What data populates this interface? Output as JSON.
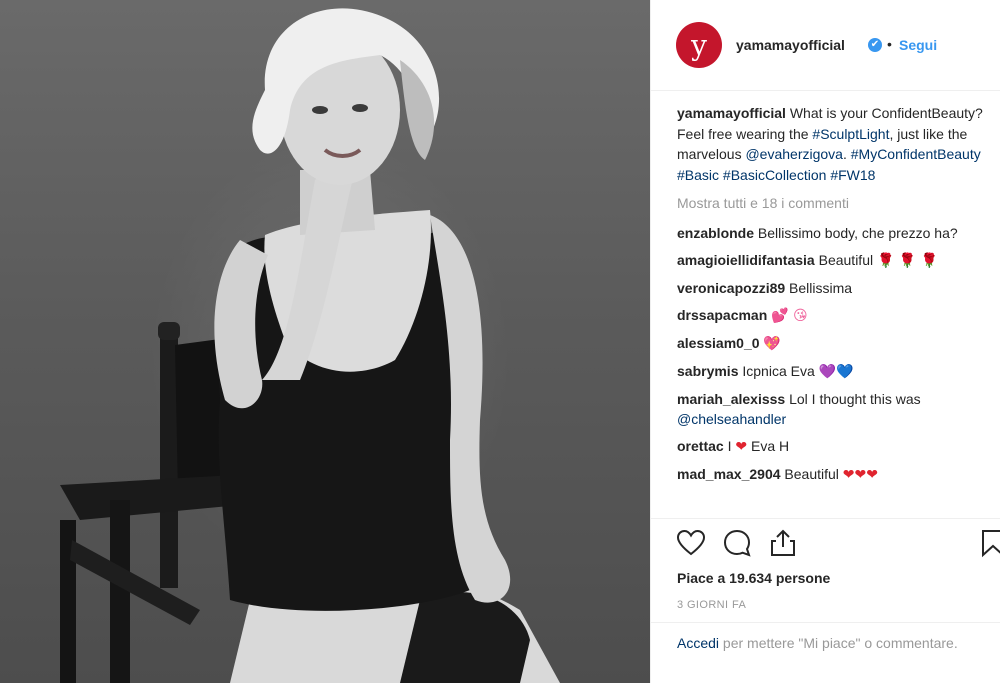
{
  "post": {
    "account": {
      "username": "yamamayofficial",
      "avatar_letter": "y",
      "avatar_color": "#c4162c",
      "verified_glyph": "✔",
      "separator": "•",
      "follow_label": "Segui",
      "follow_color": "#3897f0"
    },
    "caption": {
      "username": "yamamayofficial",
      "text_1": " What is your ConfidentBeauty? Feel free wearing the ",
      "tag_1": "#SculptLight",
      "text_2": ", just like the marvelous ",
      "tag_2": "@evaherzigova",
      "text_3": ". ",
      "tag_3": "#MyConfidentBeauty",
      "tag_4": "#Basic",
      "tag_5": "#BasicCollection",
      "tag_6": "#FW18"
    },
    "show_all_comments": "Mostra tutti e 18 i commenti",
    "comments": [
      {
        "username": "enzablonde",
        "text": "Bellissimo body, che prezzo ha?"
      },
      {
        "username": "amagioiellidifantasia",
        "text": "Beautiful ",
        "emoji": "🌹 🌹 🌹"
      },
      {
        "username": "veronicapozzi89",
        "text": "Bellissima"
      },
      {
        "username": "drssapacman",
        "text": "",
        "emoji": "💕 😘"
      },
      {
        "username": "alessiam0_0",
        "text": "",
        "emoji": "💖"
      },
      {
        "username": "sabrymis",
        "text": "Icpnica Eva ",
        "emoji": "💜💙"
      },
      {
        "username": "mariah_alexisss",
        "text": "Lol I thought this was ",
        "tag": "@chelseahandler"
      },
      {
        "username": "orettac",
        "text": "I ",
        "emoji": "❤",
        "text_after": " Eva H"
      },
      {
        "username": "mad_max_2904",
        "text": "Beautiful ",
        "emoji": "❤❤❤"
      }
    ],
    "likes_text": "Piace a 19.634 persone",
    "time_ago": "3 GIORNI FA",
    "login": {
      "link": "Accedi",
      "text": " per mettere \"Mi piace\" o commentare."
    },
    "icons": [
      "heart-icon",
      "comment-icon",
      "share-icon",
      "bookmark-icon"
    ]
  }
}
